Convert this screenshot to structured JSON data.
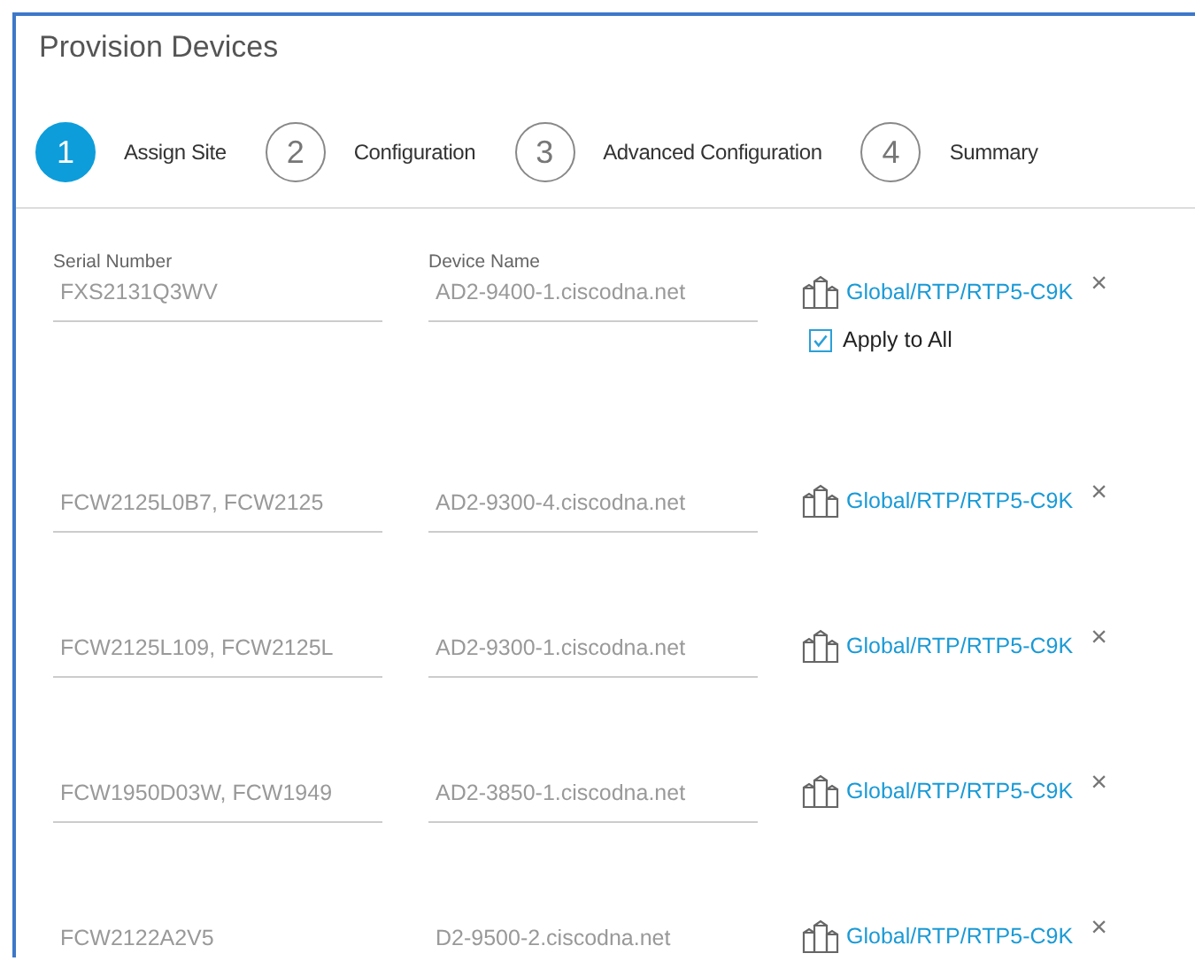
{
  "title": "Provision Devices",
  "steps": [
    {
      "number": "1",
      "label": "Assign Site",
      "selected": true
    },
    {
      "number": "2",
      "label": "Configuration",
      "selected": false
    },
    {
      "number": "3",
      "label": "Advanced Configuration",
      "selected": false
    },
    {
      "number": "4",
      "label": "Summary",
      "selected": false
    }
  ],
  "rows": [
    {
      "serial_label": "Serial Number",
      "device_label": "Device Name",
      "serial": "FXS2131Q3WV",
      "device": "AD2-9400-1.ciscodna.net",
      "site": "Global/RTP/RTP5-C9K",
      "remove": "×",
      "apply_to_all": {
        "label": "Apply to All",
        "checked": true
      }
    },
    {
      "serial": "FCW2125L0B7, FCW2125",
      "device": "AD2-9300-4.ciscodna.net",
      "site": "Global/RTP/RTP5-C9K",
      "remove": "×"
    },
    {
      "serial": "FCW2125L109, FCW2125L",
      "device": "AD2-9300-1.ciscodna.net",
      "site": "Global/RTP/RTP5-C9K",
      "remove": "×"
    },
    {
      "serial": "FCW1950D03W, FCW1949",
      "device": "AD2-3850-1.ciscodna.net",
      "site": "Global/RTP/RTP5-C9K",
      "remove": "×"
    },
    {
      "serial": "FCW2122A2V5",
      "device": "D2-9500-2.ciscodna.net",
      "site": "Global/RTP/RTP5-C9K",
      "remove": "×"
    }
  ]
}
